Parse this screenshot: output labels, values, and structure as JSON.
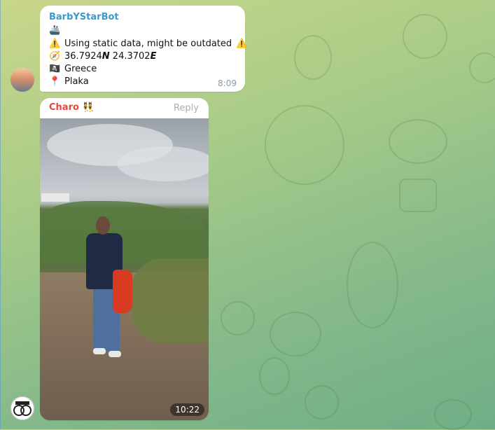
{
  "bot_message": {
    "sender": "BarbYStarBot",
    "ship_emoji": "🚢",
    "warning_emoji": "⚠️",
    "warning_text": "Using static data, might be outdated",
    "compass_emoji": "🧭",
    "lat_value": "36.7924",
    "lat_dir": "N",
    "lon_value": "24.3702",
    "lon_dir": "E",
    "flag_emoji": "🏴‍☠️",
    "country": "Greece",
    "pin_emoji": "📍",
    "place": "Plaka",
    "time": "8:09"
  },
  "photo_message": {
    "sender": "Charo",
    "sender_emoji": "👯",
    "reply_label": "Reply",
    "time": "10:22"
  },
  "colors": {
    "bot_name": "#3a9bc9",
    "charo_name": "#e14b3f",
    "bubble": "#ffffff"
  }
}
